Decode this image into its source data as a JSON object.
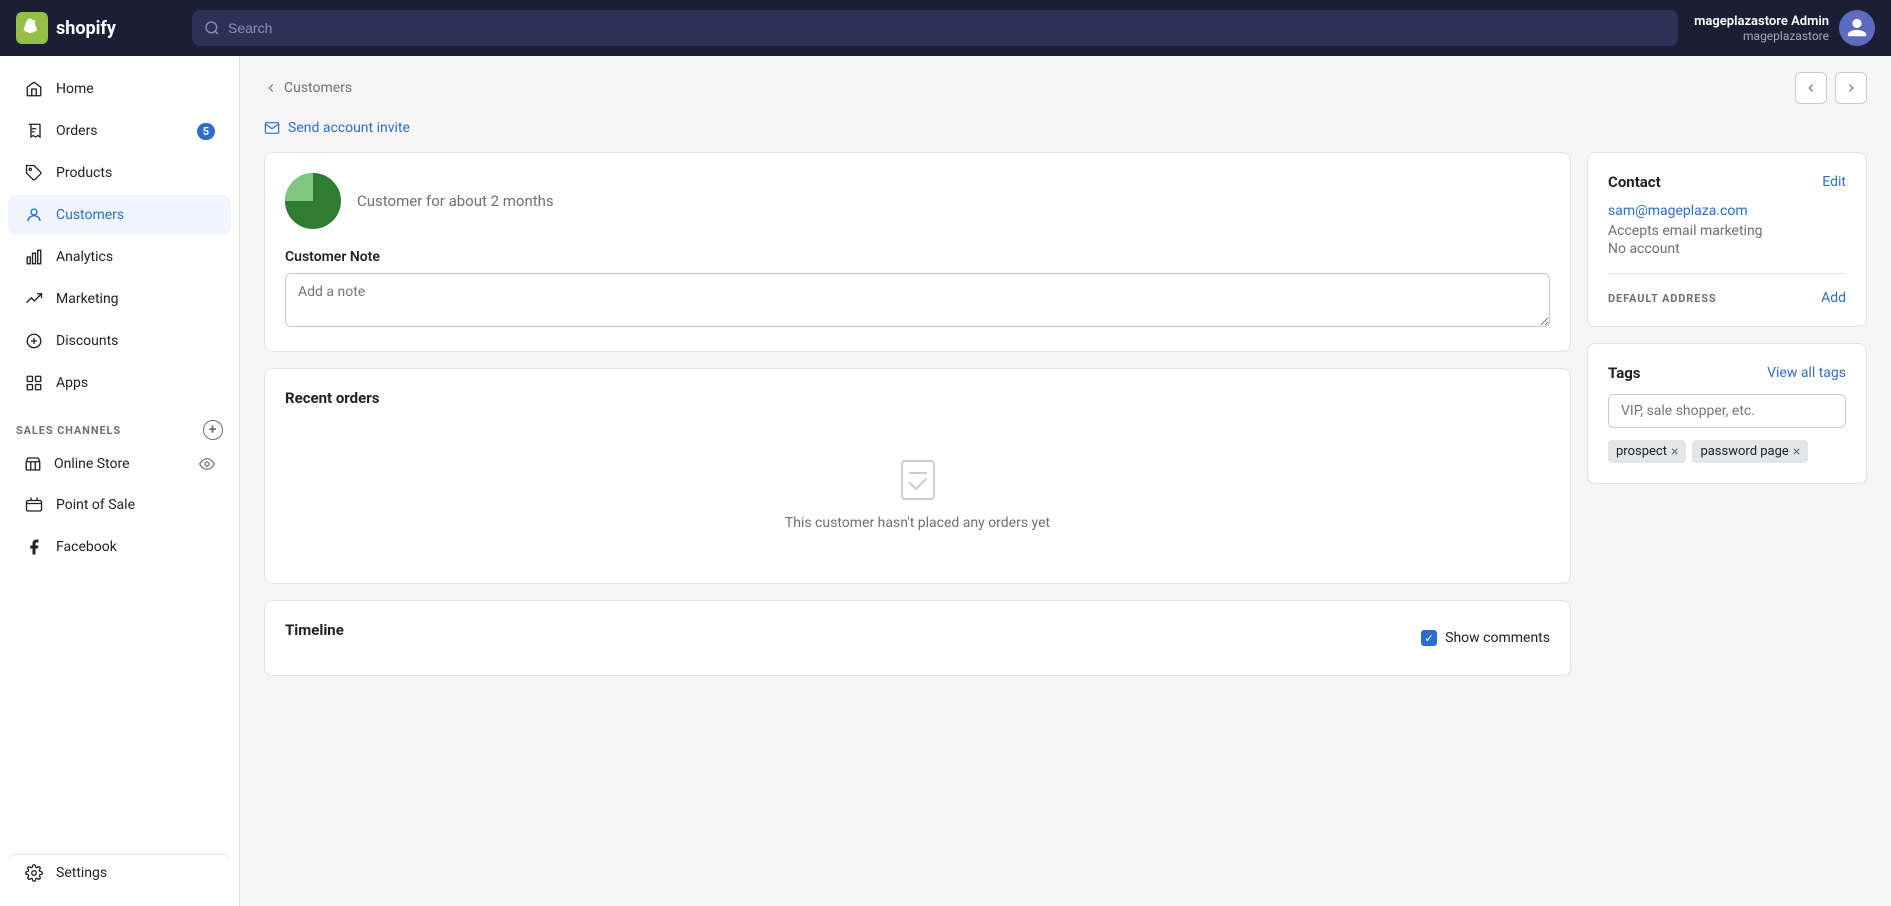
{
  "app": {
    "name": "shopify",
    "logo_text": "shopify"
  },
  "topnav": {
    "search_placeholder": "Search",
    "user_name": "mageplazastore Admin",
    "user_store": "mageplazastore"
  },
  "sidebar": {
    "items": [
      {
        "id": "home",
        "label": "Home",
        "icon": "home-icon",
        "active": false
      },
      {
        "id": "orders",
        "label": "Orders",
        "icon": "orders-icon",
        "active": false,
        "badge": "5"
      },
      {
        "id": "products",
        "label": "Products",
        "icon": "products-icon",
        "active": false
      },
      {
        "id": "customers",
        "label": "Customers",
        "icon": "customers-icon",
        "active": true
      },
      {
        "id": "analytics",
        "label": "Analytics",
        "icon": "analytics-icon",
        "active": false
      },
      {
        "id": "marketing",
        "label": "Marketing",
        "icon": "marketing-icon",
        "active": false
      },
      {
        "id": "discounts",
        "label": "Discounts",
        "icon": "discounts-icon",
        "active": false
      },
      {
        "id": "apps",
        "label": "Apps",
        "icon": "apps-icon",
        "active": false
      }
    ],
    "section_label": "SALES CHANNELS",
    "channels": [
      {
        "id": "online-store",
        "label": "Online Store",
        "icon": "store-icon"
      },
      {
        "id": "point-of-sale",
        "label": "Point of Sale",
        "icon": "pos-icon"
      },
      {
        "id": "facebook",
        "label": "Facebook",
        "icon": "facebook-icon"
      }
    ],
    "settings_label": "Settings"
  },
  "breadcrumb": {
    "back_label": "Customers"
  },
  "send_invite": {
    "label": "Send account invite"
  },
  "customer_header": {
    "since_text": "Customer for about 2 months"
  },
  "customer_note": {
    "label": "Customer Note",
    "placeholder": "Add a note"
  },
  "recent_orders": {
    "title": "Recent orders",
    "empty_text": "This customer hasn't placed any orders yet"
  },
  "timeline": {
    "title": "Timeline",
    "show_comments_label": "Show comments"
  },
  "contact": {
    "title": "Contact",
    "edit_label": "Edit",
    "email": "sam@mageplaza.com",
    "marketing_text": "Accepts email marketing",
    "account_text": "No account"
  },
  "default_address": {
    "title": "DEFAULT ADDRESS",
    "add_label": "Add"
  },
  "tags": {
    "title": "Tags",
    "view_all_label": "View all tags",
    "input_placeholder": "VIP, sale shopper, etc.",
    "items": [
      {
        "label": "prospect"
      },
      {
        "label": "password page"
      }
    ]
  }
}
